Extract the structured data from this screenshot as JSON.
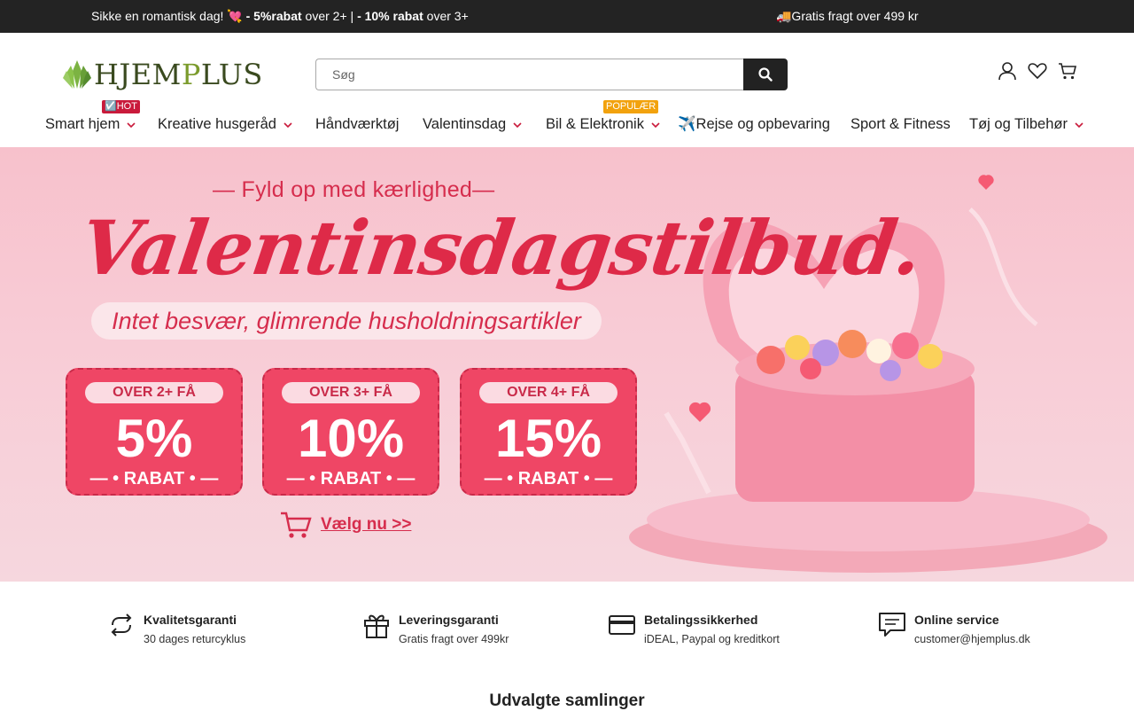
{
  "announcement": {
    "left_a": "Sikke en romantisk dag! 💘",
    "left_b": " - 5%rabat",
    "left_c": " over 2+ | ",
    "left_d": "- 10% rabat",
    "left_e": " over 3+",
    "right": "🚚Gratis fragt over 499 kr"
  },
  "logo": {
    "part1": "HJEM",
    "part2": "P",
    "part3": "LUS"
  },
  "search": {
    "placeholder": "Søg"
  },
  "nav": {
    "items": [
      {
        "label": "Smart hjem"
      },
      {
        "label": "Kreative husgeråd"
      },
      {
        "label": "Håndværktøj"
      },
      {
        "label": "Valentinsdag"
      },
      {
        "label": "Bil & Elektronik"
      },
      {
        "label": "✈️Rejse og opbevaring"
      },
      {
        "label": "Sport & Fitness"
      },
      {
        "label": "Tøj og Tilbehør"
      }
    ],
    "badge_hot": "☑️HOT",
    "badge_popular": "POPULÆR"
  },
  "hero": {
    "subtitle": "— Fyld op med kærlighed—",
    "title": "Valentinsdagstilbud.",
    "pill": "Intet besvær, glimrende husholdningsartikler",
    "cards": [
      {
        "over": "OVER 2+ FÅ",
        "pct": "5%",
        "rabat": "— • RABAT • —"
      },
      {
        "over": "OVER 3+ FÅ",
        "pct": "10%",
        "rabat": "— • RABAT • —"
      },
      {
        "over": "OVER 4+ FÅ",
        "pct": "15%",
        "rabat": "— • RABAT • —"
      }
    ],
    "cta": "Vælg nu >>"
  },
  "features": [
    {
      "title": "Kvalitetsgaranti",
      "text": "30 dages returcyklus",
      "icon": "refresh-icon"
    },
    {
      "title": "Leveringsgaranti",
      "text": "Gratis fragt over 499kr",
      "icon": "gift-icon"
    },
    {
      "title": "Betalingssikkerhed",
      "text": "iDEAL, Paypal og kreditkort",
      "icon": "credit-card-icon"
    },
    {
      "title": "Online service",
      "text": "customer@hjemplus.dk",
      "icon": "chat-icon"
    }
  ],
  "collections_title": "Udvalgte samlinger"
}
